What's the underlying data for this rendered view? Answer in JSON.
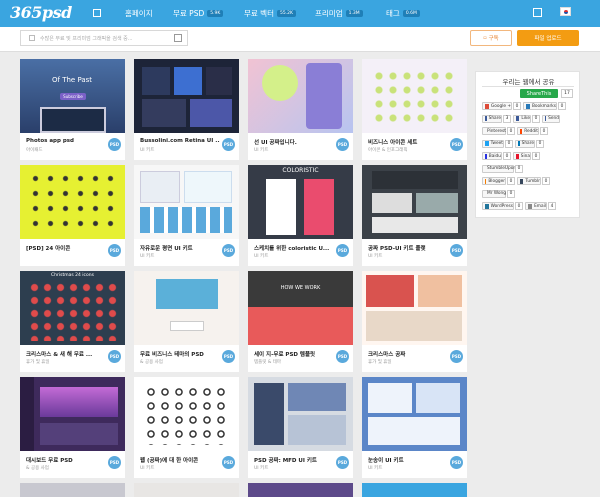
{
  "logo": "365psd",
  "nav": {
    "home": "홈페이지",
    "psd": "무료 PSD",
    "psd_count": "5.9K",
    "vector": "무료 벡터",
    "vector_count": "55.2K",
    "premium": "프리미엄",
    "premium_count": "1.3M",
    "tags": "태그",
    "tags_count": "0.6M"
  },
  "search": {
    "placeholder": "수많은 무료 및 프리미엄 그래픽을 검색 중..."
  },
  "buttons": {
    "subscribe": "구독",
    "upload": "파일 업로드"
  },
  "cards": [
    {
      "title": "Photos app psd",
      "sub": "아이패드",
      "badge": "PSD",
      "thumb_text": "Of The Past",
      "thumb_btn": "Subscribe"
    },
    {
      "title": "Bussolini.com Retina UI ...",
      "sub": "UI 키트",
      "badge": "PSD"
    },
    {
      "title": "선 UI 공짜입니다.",
      "sub": "UI 키트",
      "badge": "PSD"
    },
    {
      "title": "비즈니스 아이콘 세트",
      "sub": "아이콘 & 인포그래픽",
      "badge": "PSD"
    },
    {
      "title": "[PSD] 24 아이콘",
      "sub": "",
      "badge": "PSD"
    },
    {
      "title": "자유로운 평면 UI 키트",
      "sub": "UI 키트",
      "badge": "PSD"
    },
    {
      "title": "스케치를 위한 coloristic U...",
      "sub": "UI 키트",
      "badge": "PSD",
      "thumb_text": "COLORISTIC"
    },
    {
      "title": "공짜 PSD-UI 키트 플랫",
      "sub": "UI 키트",
      "badge": "PSD"
    },
    {
      "title": "크리스마스 & 새 해 무료 ...",
      "sub": "휴가 및 휴일",
      "badge": "PSD",
      "thumb_text": "Christmas 24 icons"
    },
    {
      "title": "무료 비즈니스 테마의 PSD",
      "sub": "& 공용 사업",
      "badge": "PSD"
    },
    {
      "title": "세이 지-무료 PSD 템플릿",
      "sub": "템플릿 & 테마",
      "badge": "PSD",
      "thumb_text": "HOW WE WORK"
    },
    {
      "title": "크리스마스 공짜",
      "sub": "휴가 및 휴일",
      "badge": "PSD"
    },
    {
      "title": "대시보드 무료 PSD",
      "sub": "& 공용 사업",
      "badge": "PSD"
    },
    {
      "title": "웹 (공짜)에 대 한 아이콘",
      "sub": "UI 키트",
      "badge": "PSD"
    },
    {
      "title": "PSD 공짜: MFD UI 키트",
      "sub": "UI 키트",
      "badge": "PSD"
    },
    {
      "title": "눈송이 UI 키트",
      "sub": "UI 키트",
      "badge": "PSD"
    }
  ],
  "share": {
    "title": "우리는 웹에서 공유",
    "shareit": "ShareThis",
    "shareit_count": "17",
    "items": [
      {
        "label": "Google +",
        "count": "0",
        "color": "#dd4b39"
      },
      {
        "label": "Bookmarks",
        "count": "0",
        "color": "#2a7ab8"
      },
      {
        "label": "Share",
        "count": "3",
        "color": "#3b5998"
      },
      {
        "label": "Like",
        "count": "0",
        "color": "#3b5998"
      },
      {
        "label": "Send",
        "count": "",
        "color": "#3b5998"
      },
      {
        "label": "Pinterest",
        "count": "0",
        "color": "#cb2027"
      },
      {
        "label": "Reddit",
        "count": "0",
        "color": "#ff4500"
      },
      {
        "label": "Tweet",
        "count": "0",
        "color": "#1da1f2"
      },
      {
        "label": "Share",
        "count": "0",
        "color": "#0077b5"
      },
      {
        "label": "Baidu",
        "count": "0",
        "color": "#2932e1"
      },
      {
        "label": "Sina",
        "count": "0",
        "color": "#e6162d"
      },
      {
        "label": "StumbleUpon",
        "count": "0",
        "color": "#eb4924"
      },
      {
        "label": "Blogger",
        "count": "0",
        "color": "#f57d00"
      },
      {
        "label": "Tumblr",
        "count": "0",
        "color": "#35465c"
      },
      {
        "label": "Mr Wong",
        "count": "0",
        "color": "#a34a8c"
      },
      {
        "label": "WordPress",
        "count": "0",
        "color": "#21759b"
      },
      {
        "label": "Email",
        "count": "4",
        "color": "#888888"
      }
    ]
  }
}
